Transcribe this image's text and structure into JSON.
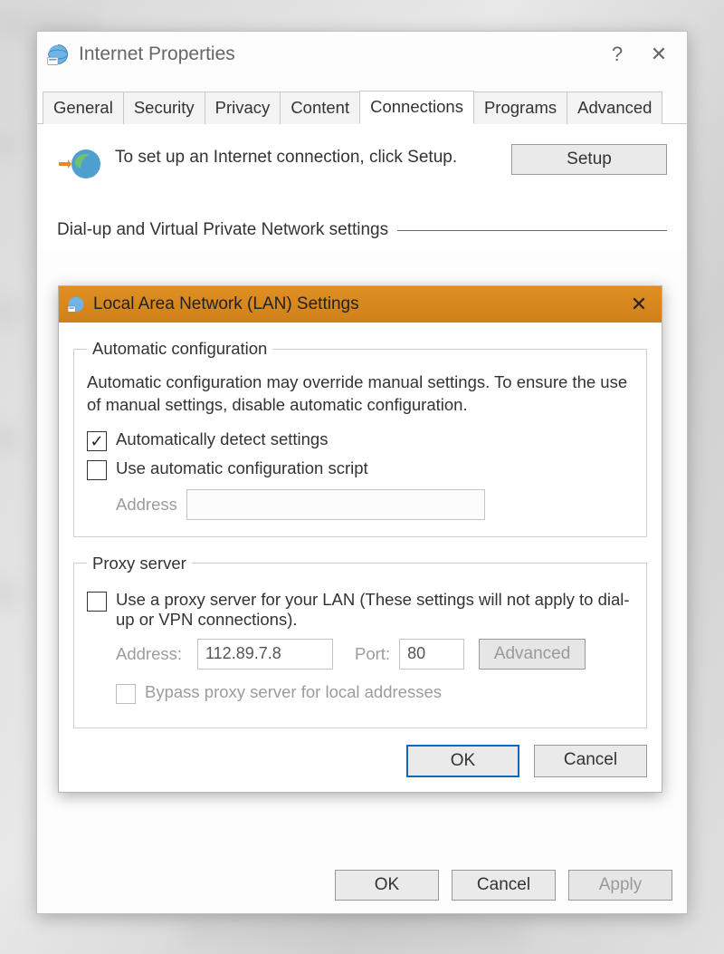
{
  "ip": {
    "title": "Internet Properties",
    "help_symbol": "?",
    "close_symbol": "✕",
    "tabs": {
      "general": "General",
      "security": "Security",
      "privacy": "Privacy",
      "content": "Content",
      "connections": "Connections",
      "programs": "Programs",
      "advanced": "Advanced"
    },
    "setup_text": "To set up an Internet connection, click Setup.",
    "setup_button": "Setup",
    "dialup_section": "Dial-up and Virtual Private Network settings",
    "footer": {
      "ok": "OK",
      "cancel": "Cancel",
      "apply": "Apply"
    }
  },
  "lan": {
    "title": "Local Area Network (LAN) Settings",
    "close_symbol": "✕",
    "auto": {
      "legend": "Automatic configuration",
      "desc": "Automatic configuration may override manual settings.  To ensure the use of manual settings, disable automatic configuration.",
      "detect_label": "Automatically detect settings",
      "detect_checked": true,
      "script_label": "Use automatic configuration script",
      "script_checked": false,
      "address_label": "Address",
      "address_value": ""
    },
    "proxy": {
      "legend": "Proxy server",
      "use_label": "Use a proxy server for your LAN (These settings will not apply to dial-up or VPN connections).",
      "use_checked": false,
      "address_label": "Address:",
      "address_value": "112.89.7.8",
      "port_label": "Port:",
      "port_value": "80",
      "advanced_button": "Advanced",
      "bypass_label": "Bypass proxy server for local addresses",
      "bypass_checked": false
    },
    "buttons": {
      "ok": "OK",
      "cancel": "Cancel"
    }
  }
}
